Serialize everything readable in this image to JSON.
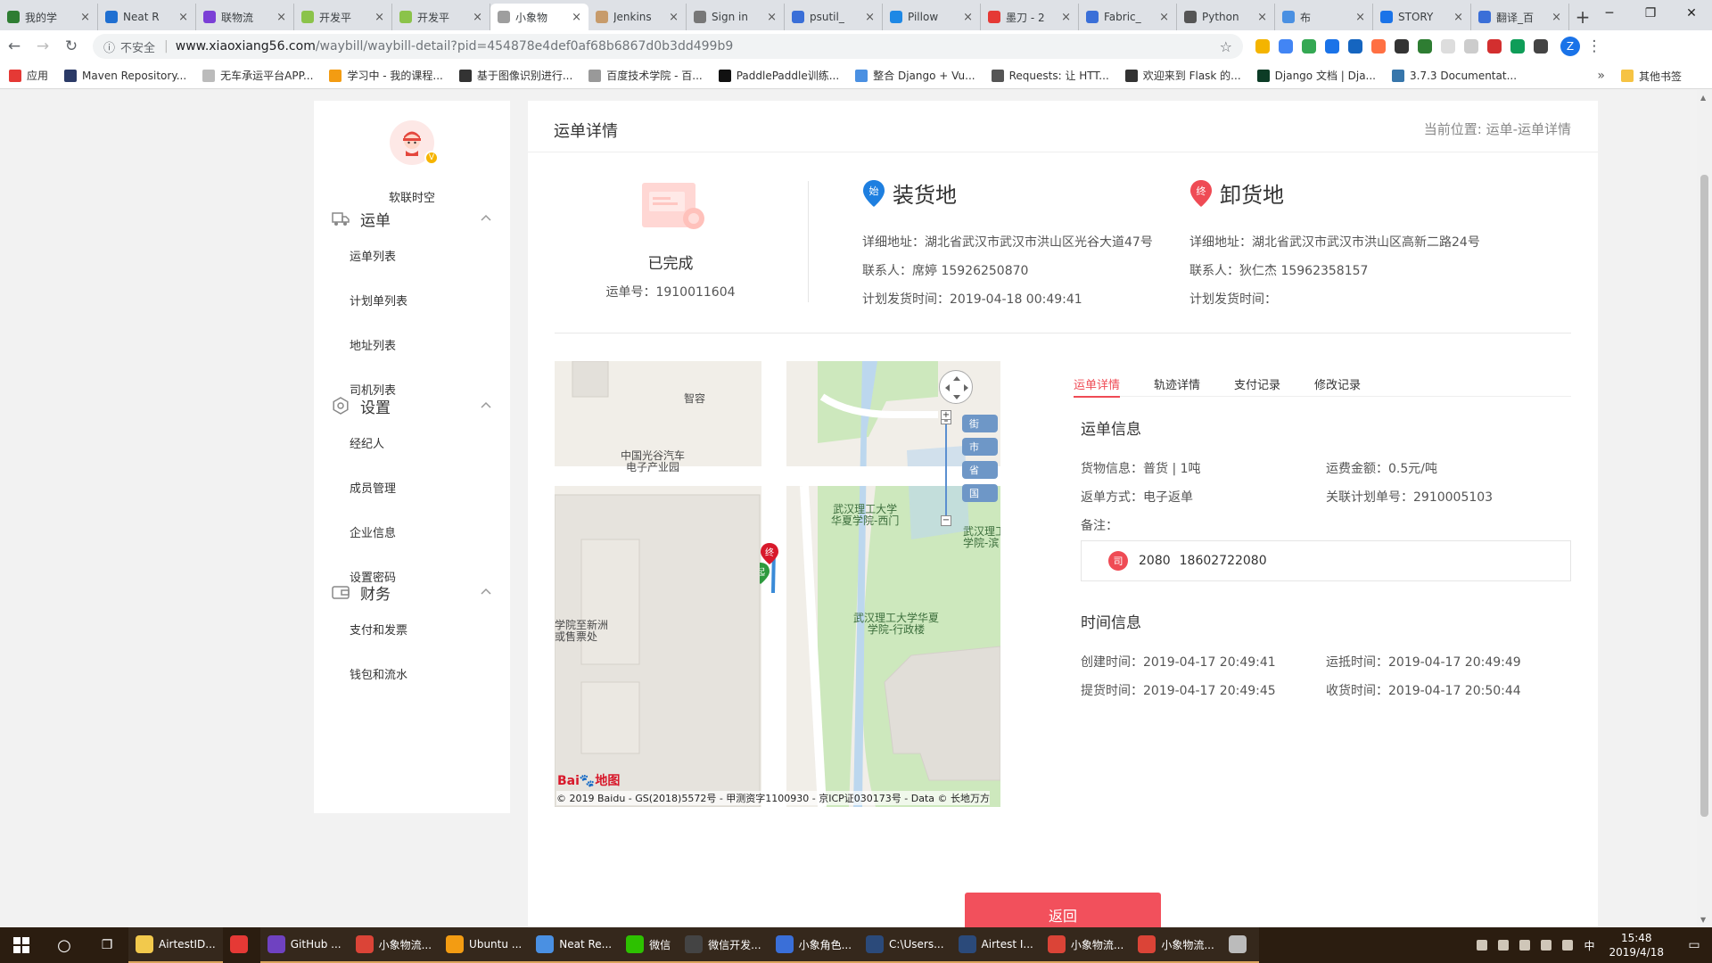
{
  "browser": {
    "tabs": [
      {
        "label": "我的学",
        "color": "#2e7d32"
      },
      {
        "label": "Neat R",
        "color": "#1f6fd1"
      },
      {
        "label": "联物流",
        "color": "#7b3fd6"
      },
      {
        "label": "开发平",
        "color": "#8bc34a"
      },
      {
        "label": "开发平",
        "color": "#8bc34a"
      },
      {
        "label": "小象物",
        "color": "#9e9e9e"
      },
      {
        "label": "Jenkins",
        "color": "#c79b6b"
      },
      {
        "label": "Sign in",
        "color": "#777777"
      },
      {
        "label": "psutil_",
        "color": "#3a6fd8"
      },
      {
        "label": "Pillow",
        "color": "#1e88e5"
      },
      {
        "label": "墨刀 - 2",
        "color": "#e53935"
      },
      {
        "label": "Fabric_",
        "color": "#3a6fd8"
      },
      {
        "label": "Python",
        "color": "#555555"
      },
      {
        "label": "布",
        "color": "#4a90e2"
      },
      {
        "label": "STORY",
        "color": "#1a73e8"
      },
      {
        "label": "翻译_百",
        "color": "#3a6fd8"
      }
    ],
    "active_tab_index": 5,
    "address": {
      "insecure_label": "不安全",
      "host": "www.xiaoxiang56.com",
      "path": "/waybill/waybill-detail?pid=454878e4def0af68b6867d0b3dd499b9"
    },
    "profile_initial": "Z",
    "bookmarks": [
      {
        "label": "应用",
        "color": "#e53935"
      },
      {
        "label": "Maven Repository...",
        "color": "#2b3a67"
      },
      {
        "label": "无车承运平台APP...",
        "color": "#bbbbbb"
      },
      {
        "label": "学习中 - 我的课程...",
        "color": "#f39c12"
      },
      {
        "label": "基于图像识别进行...",
        "color": "#333333"
      },
      {
        "label": "百度技术学院 - 百...",
        "color": "#999999"
      },
      {
        "label": "PaddlePaddle训练...",
        "color": "#111111"
      },
      {
        "label": "整合 Django + Vu...",
        "color": "#4a90e2"
      },
      {
        "label": "Requests: 让 HTT...",
        "color": "#555555"
      },
      {
        "label": "欢迎来到 Flask 的...",
        "color": "#333333"
      },
      {
        "label": "Django 文档 | Dja...",
        "color": "#0c3c26"
      },
      {
        "label": "3.7.3 Documentat...",
        "color": "#3776ab"
      }
    ],
    "bookmarks_more": "»",
    "other_bookmarks": "其他书签"
  },
  "sidebar": {
    "username": "软联时空",
    "vip_badge": "V",
    "groups": [
      {
        "label": "运单",
        "icon": "truck-icon",
        "items": [
          "运单列表",
          "计划单列表",
          "地址列表",
          "司机列表"
        ]
      },
      {
        "label": "设置",
        "icon": "gear-icon",
        "items": [
          "经纪人",
          "成员管理",
          "企业信息",
          "设置密码"
        ]
      },
      {
        "label": "财务",
        "icon": "wallet-icon",
        "items": [
          "支付和发票",
          "钱包和流水"
        ]
      }
    ]
  },
  "main": {
    "title": "运单详情",
    "breadcrumb": "当前位置: 运单-运单详情",
    "status": "已完成",
    "waybill_no_label": "运单号：",
    "waybill_no": "1910011604",
    "loading": {
      "badge": "始",
      "title": "装货地",
      "address": "详细地址：湖北省武汉市武汉市洪山区光谷大道47号",
      "contact": "联系人：席婷 15926250870",
      "plan_time": "计划发货时间：2019-04-18 00:49:41"
    },
    "unloading": {
      "badge": "终",
      "title": "卸货地",
      "address": "详细地址：湖北省武汉市武汉市洪山区高新二路24号",
      "contact": "联系人：狄仁杰 15962358157",
      "plan_time": "计划发货时间："
    },
    "map": {
      "labels": [
        "智容",
        "中国光谷汽车\n电子产业园",
        "武汉理工大学\n华夏学院-西门",
        "武汉理工大学华夏\n学院-行政楼",
        "学院至新洲\n或售票处",
        "武汉理工\n学院-滨"
      ],
      "zoom_in": "+",
      "zoom_out": "−",
      "scale_tags": [
        "街",
        "市",
        "省",
        "国"
      ],
      "marker_end": "终",
      "marker_start": "起",
      "logo_a": "Bai",
      "logo_b": "地图",
      "copyright": "© 2019 Baidu - GS(2018)5572号 - 甲测资字1100930 - 京ICP证030173号 - Data © 长地万方"
    },
    "detail_tabs": [
      "运单详情",
      "轨迹详情",
      "支付记录",
      "修改记录"
    ],
    "active_detail_tab": 0,
    "waybill_info": {
      "title": "运单信息",
      "cargo": "货物信息：普货 | 1吨",
      "freight": "运费金额：0.5元/吨",
      "return_mode": "返单方式：电子返单",
      "related_plan": "关联计划单号：2910005103",
      "remark": "备注："
    },
    "driver": {
      "badge": "司",
      "name": "2080",
      "phone": "18602722080"
    },
    "time_info": {
      "title": "时间信息",
      "created": "创建时间：2019-04-17 20:49:41",
      "arrived": "运抵时间：2019-04-17 20:49:49",
      "picked": "提货时间：2019-04-17 20:49:45",
      "received": "收货时间：2019-04-17 20:50:44"
    },
    "back_button": "返回"
  },
  "taskbar": {
    "apps": [
      {
        "label": "AirtestID...",
        "color": "#f2c94c",
        "open": true
      },
      {
        "label": "",
        "color": "#e53935",
        "open": false
      },
      {
        "label": "GitHub ...",
        "color": "#6f42c1",
        "open": true
      },
      {
        "label": "小象物流...",
        "color": "#db4437",
        "open": true
      },
      {
        "label": "Ubuntu ...",
        "color": "#f39c12",
        "open": true
      },
      {
        "label": "Neat Re...",
        "color": "#4a90e2",
        "open": true
      },
      {
        "label": "微信",
        "color": "#2dc100",
        "open": true
      },
      {
        "label": "微信开发...",
        "color": "#444444",
        "open": true
      },
      {
        "label": "小象角色...",
        "color": "#3a6fd8",
        "open": true
      },
      {
        "label": "C:\\Users...",
        "color": "#2b4a7a",
        "open": true
      },
      {
        "label": "Airtest I...",
        "color": "#2b4a7a",
        "open": true
      },
      {
        "label": "小象物流...",
        "color": "#db4437",
        "open": true
      },
      {
        "label": "小象物流...",
        "color": "#db4437",
        "open": true
      },
      {
        "label": "",
        "color": "#bbbbbb",
        "open": true
      }
    ],
    "ime": "中",
    "time": "15:48",
    "date": "2019/4/18"
  }
}
